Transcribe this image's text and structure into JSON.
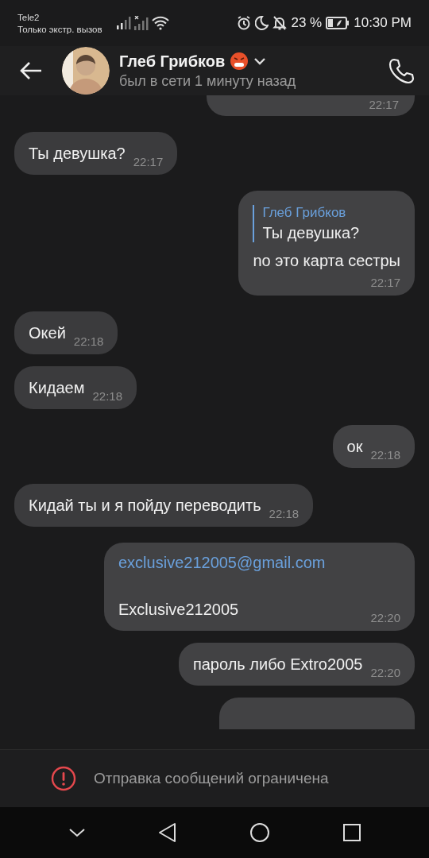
{
  "status_bar": {
    "carrier": "Tele2",
    "network_note": "Только экстр. вызов",
    "battery": "23 %",
    "time": "10:30 PM"
  },
  "header": {
    "name": "Глеб Грибков",
    "status": "был в сети 1 минуту назад"
  },
  "messages": [
    {
      "kind": "clipped_top",
      "outgoing": true,
      "time": "22:17"
    },
    {
      "kind": "text",
      "outgoing": false,
      "text": "Ты девушка?",
      "time": "22:17"
    },
    {
      "kind": "reply",
      "outgoing": true,
      "reply_author": "Глеб Грибков",
      "reply_text": "Ты девушка?",
      "text": "no это карта сестры",
      "time": "22:17"
    },
    {
      "kind": "text",
      "outgoing": false,
      "text": "Окей",
      "time": "22:18"
    },
    {
      "kind": "text",
      "outgoing": false,
      "text": "Кидаем",
      "time": "22:18"
    },
    {
      "kind": "text",
      "outgoing": true,
      "text": "ок",
      "time": "22:18"
    },
    {
      "kind": "text",
      "outgoing": false,
      "text": "Кидай ты и я пойду переводить",
      "time": "22:18"
    },
    {
      "kind": "link_text",
      "outgoing": true,
      "link": "exclusive212005@gmail.com",
      "text": "Exclusive212005",
      "time": "22:20"
    },
    {
      "kind": "text",
      "outgoing": true,
      "text": "пароль либо Extro2005",
      "time": "22:20"
    },
    {
      "kind": "clipped_bottom",
      "outgoing": true
    }
  ],
  "restriction_banner": {
    "text": "Отправка сообщений ограничена"
  }
}
